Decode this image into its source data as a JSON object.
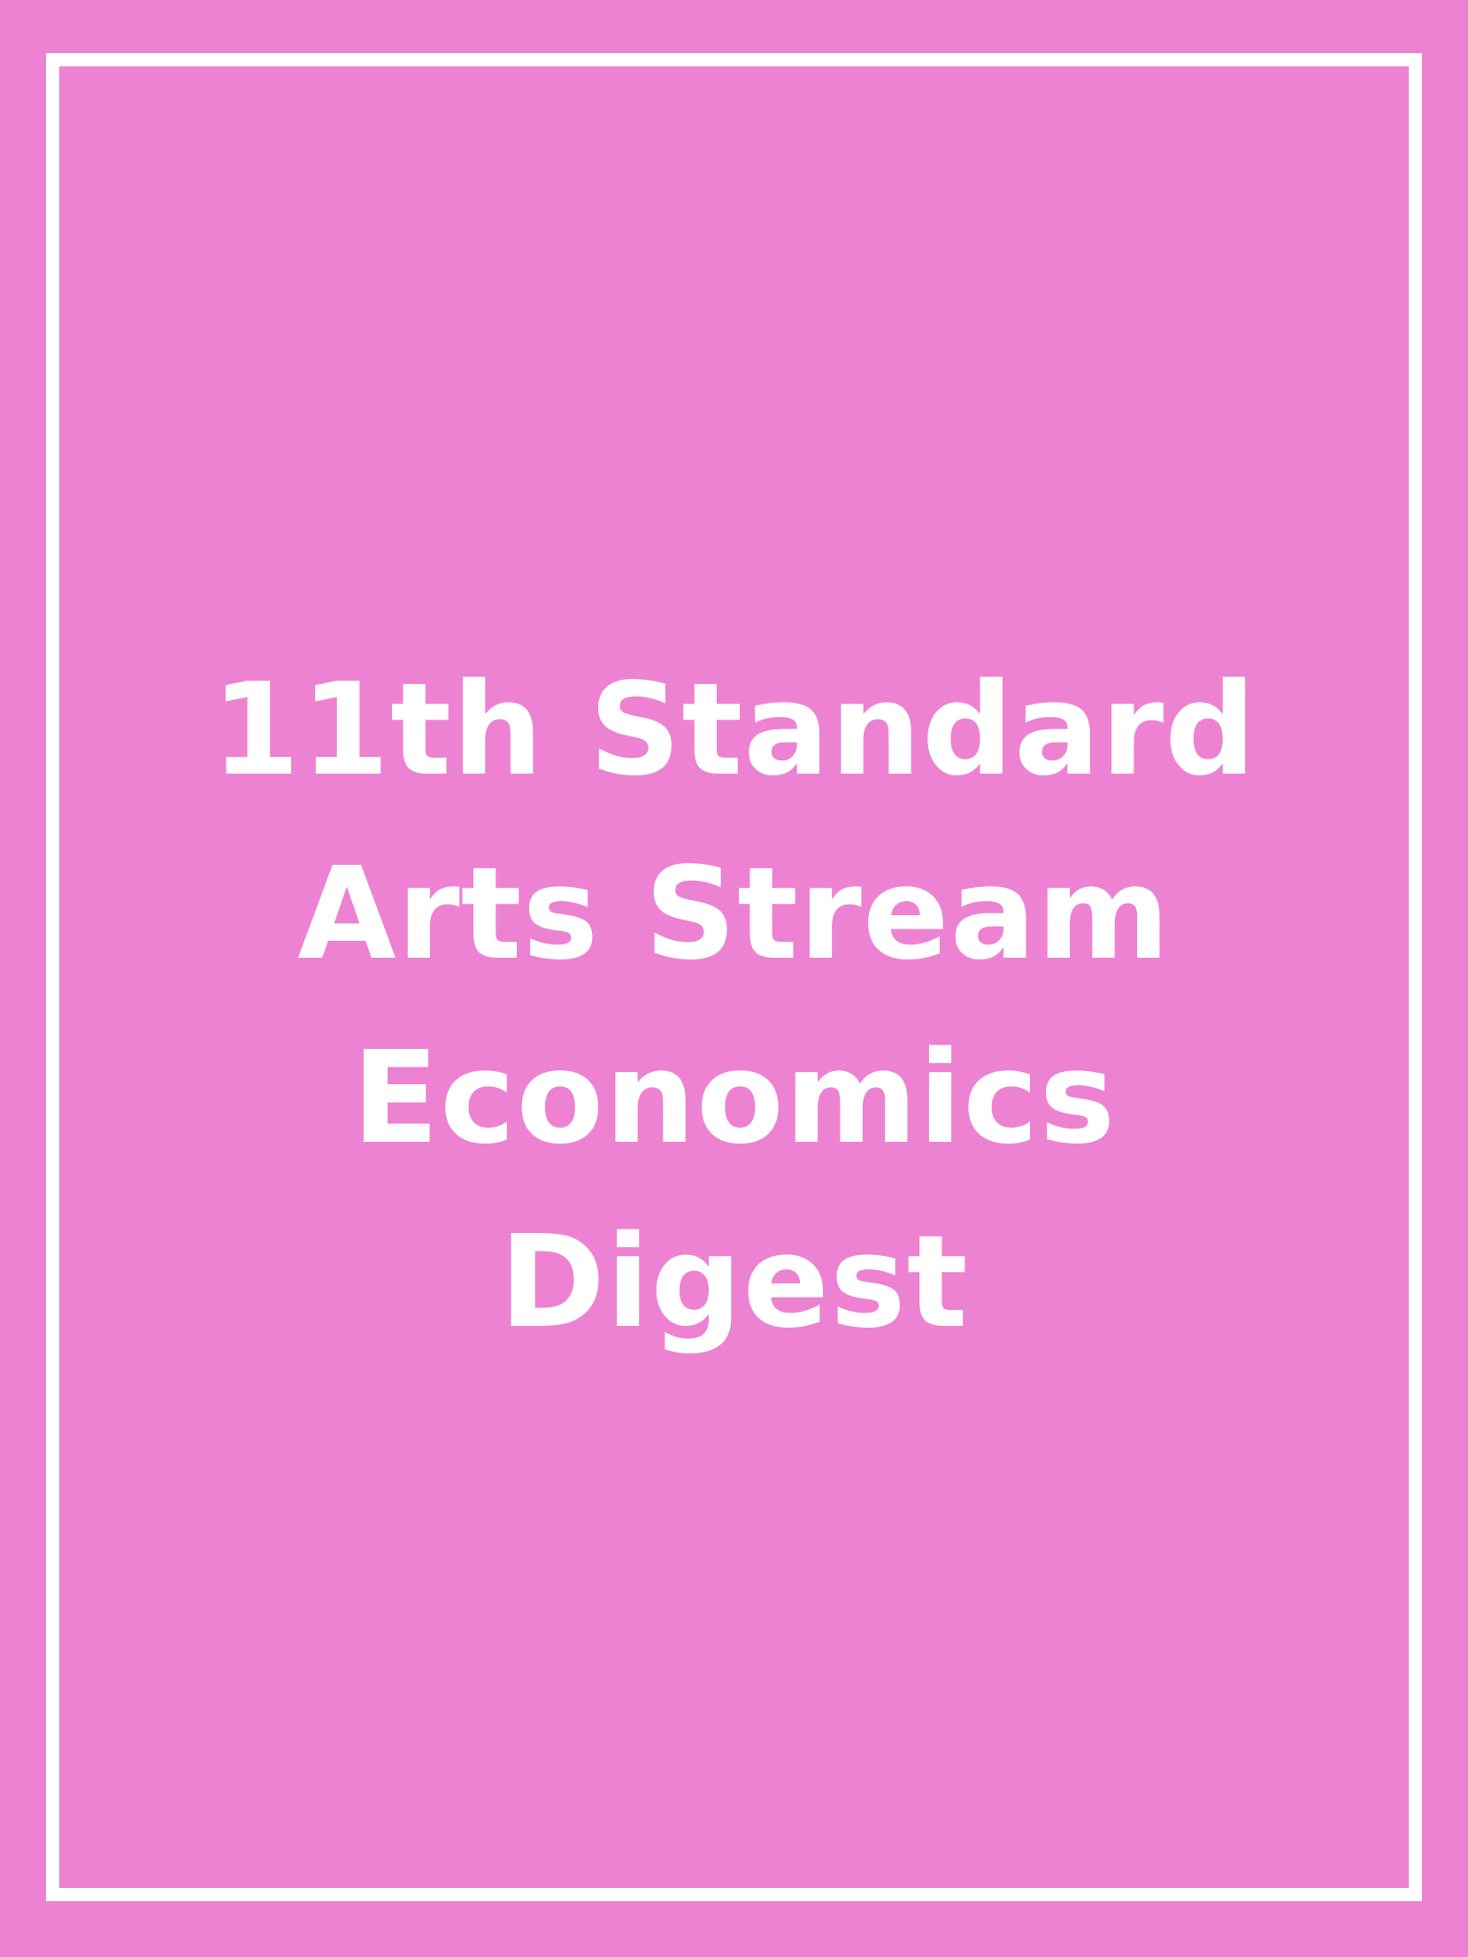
{
  "cover": {
    "title_lines": [
      "11th Standard",
      "Arts Stream",
      "Economics",
      "Digest"
    ]
  },
  "colors": {
    "background": "#ed82d2",
    "frame": "#ffffff",
    "text": "#ffffff"
  }
}
